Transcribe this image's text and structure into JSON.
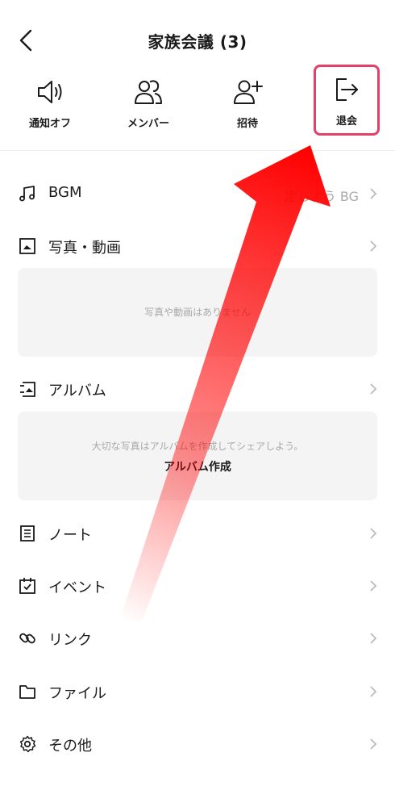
{
  "header": {
    "title": "家族会議 (3)"
  },
  "actions": [
    {
      "label": "通知オフ",
      "icon": "speaker-icon"
    },
    {
      "label": "メンバー",
      "icon": "members-icon"
    },
    {
      "label": "招待",
      "icon": "add-person-icon"
    },
    {
      "label": "退会",
      "icon": "leave-icon"
    }
  ],
  "menu": {
    "bgm": {
      "label": "BGM",
      "value": "定しよう BG"
    },
    "photos": {
      "label": "写真・動画",
      "empty_note": "写真や動画はありません"
    },
    "album": {
      "label": "アルバム",
      "note": "大切な写真はアルバムを作成してシェアしよう。",
      "create_button": "アルバム作成"
    },
    "note": {
      "label": "ノート"
    },
    "event": {
      "label": "イベント"
    },
    "link": {
      "label": "リンク"
    },
    "file": {
      "label": "ファイル"
    },
    "other": {
      "label": "その他"
    }
  },
  "colors": {
    "highlight_border": "#e3406b",
    "arrow": "#ff0000",
    "box_background": "#f5f4f5"
  }
}
